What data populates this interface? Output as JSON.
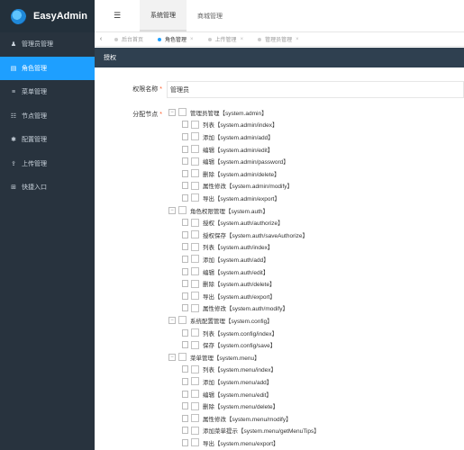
{
  "brand": {
    "name": "EasyAdmin"
  },
  "sidebar": {
    "items": [
      {
        "label": "管理员管理",
        "icon": "♟"
      },
      {
        "label": "角色管理",
        "icon": "▤",
        "active": true
      },
      {
        "label": "菜单管理",
        "icon": "≡"
      },
      {
        "label": "节点管理",
        "icon": "☷"
      },
      {
        "label": "配置管理",
        "icon": "✱"
      },
      {
        "label": "上传管理",
        "icon": "⇪"
      },
      {
        "label": "快捷入口",
        "icon": "⊞"
      }
    ]
  },
  "topbar": {
    "toggle_icon": "☰",
    "tabs": [
      {
        "label": "系统管理",
        "active": true
      },
      {
        "label": "商城管理"
      }
    ]
  },
  "tabbar": {
    "left_arrow": "‹",
    "tabs": [
      {
        "label": "后台首页"
      },
      {
        "label": "角色管理",
        "active": true
      },
      {
        "label": "上传管理"
      },
      {
        "label": "管理员管理"
      }
    ],
    "close_glyph": "×"
  },
  "panel": {
    "title": "授权"
  },
  "form": {
    "name_label": "权限名称",
    "name_value": "管理员",
    "nodes_label": "分配节点",
    "required_mark": "*"
  },
  "tree": [
    {
      "text": "管理员管理【system.admin】",
      "level": 0
    },
    {
      "text": "列表【system.admin/index】",
      "level": 1
    },
    {
      "text": "添加【system.admin/add】",
      "level": 1
    },
    {
      "text": "编辑【system.admin/edit】",
      "level": 1
    },
    {
      "text": "编辑【system.admin/password】",
      "level": 1
    },
    {
      "text": "删除【system.admin/delete】",
      "level": 1
    },
    {
      "text": "属性修改【system.admin/modify】",
      "level": 1
    },
    {
      "text": "导出【system.admin/export】",
      "level": 1
    },
    {
      "text": "角色权限管理【system.auth】",
      "level": 0
    },
    {
      "text": "授权【system.auth/authorize】",
      "level": 1
    },
    {
      "text": "授权保存【system.auth/saveAuthorize】",
      "level": 1
    },
    {
      "text": "列表【system.auth/index】",
      "level": 1
    },
    {
      "text": "添加【system.auth/add】",
      "level": 1
    },
    {
      "text": "编辑【system.auth/edit】",
      "level": 1
    },
    {
      "text": "删除【system.auth/delete】",
      "level": 1
    },
    {
      "text": "导出【system.auth/export】",
      "level": 1
    },
    {
      "text": "属性修改【system.auth/modify】",
      "level": 1
    },
    {
      "text": "系统配置管理【system.config】",
      "level": 0
    },
    {
      "text": "列表【system.config/index】",
      "level": 1
    },
    {
      "text": "保存【system.config/save】",
      "level": 1
    },
    {
      "text": "菜单管理【system.menu】",
      "level": 0
    },
    {
      "text": "列表【system.menu/index】",
      "level": 1
    },
    {
      "text": "添加【system.menu/add】",
      "level": 1
    },
    {
      "text": "编辑【system.menu/edit】",
      "level": 1
    },
    {
      "text": "删除【system.menu/delete】",
      "level": 1
    },
    {
      "text": "属性修改【system.menu/modify】",
      "level": 1
    },
    {
      "text": "添加菜单提示【system.menu/getMenuTips】",
      "level": 1
    },
    {
      "text": "导出【system.menu/export】",
      "level": 1
    }
  ],
  "tree_glyphs": {
    "expanded": "−"
  }
}
